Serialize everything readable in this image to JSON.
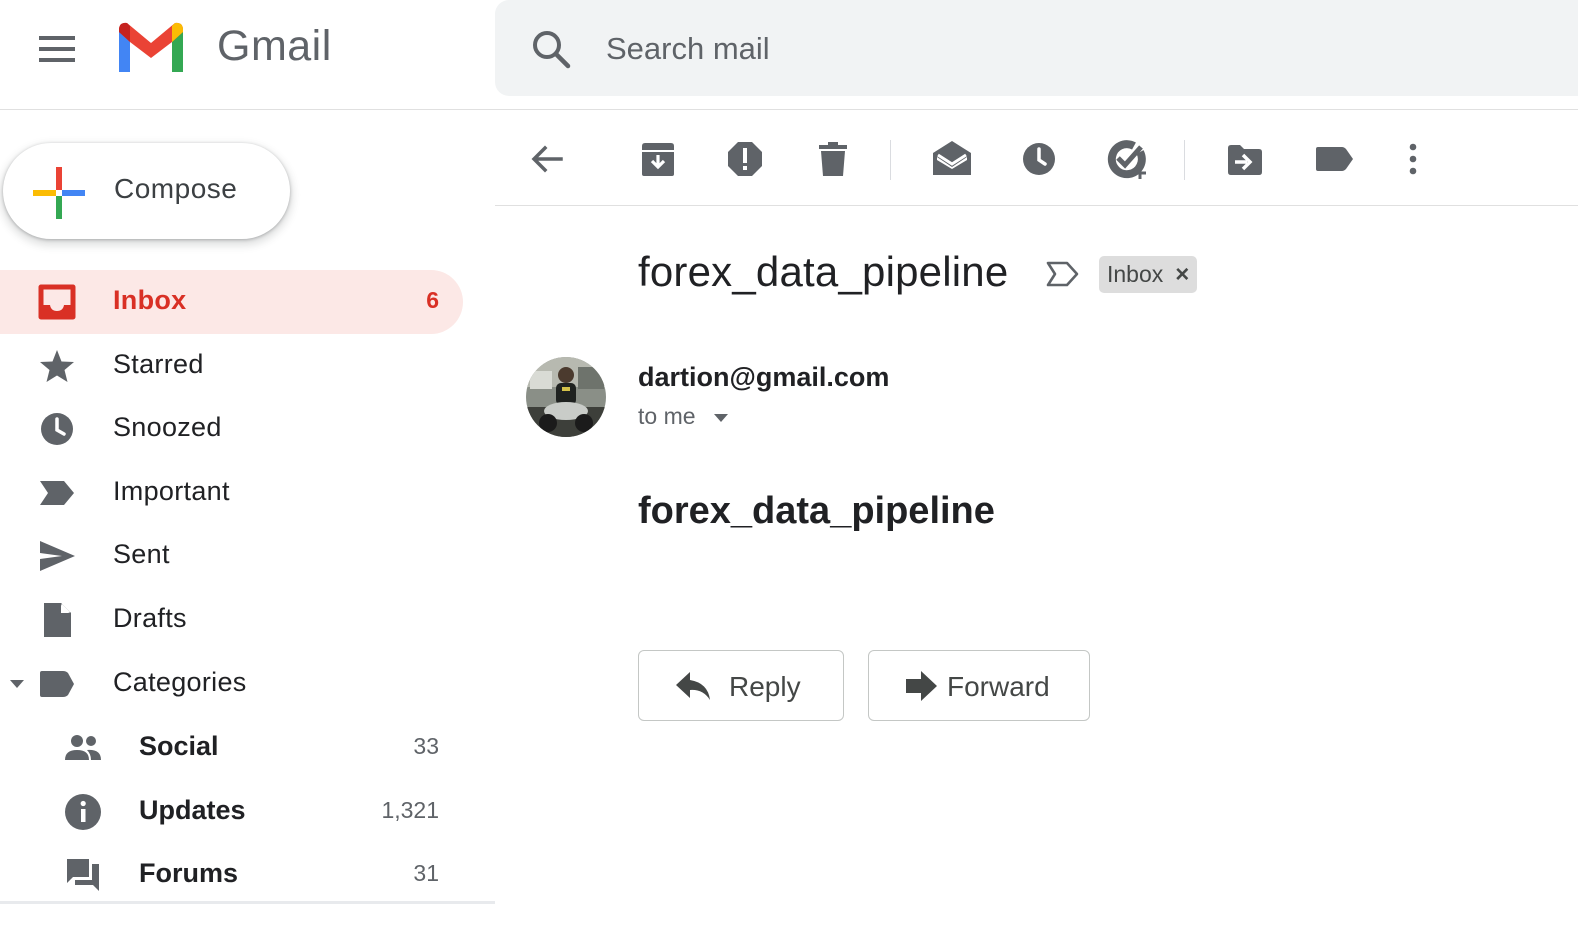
{
  "app": {
    "name": "Gmail"
  },
  "search": {
    "placeholder": "Search mail"
  },
  "compose": {
    "label": "Compose"
  },
  "sidebar": {
    "items": [
      {
        "label": "Inbox",
        "count": "6",
        "icon": "inbox-icon",
        "active": true
      },
      {
        "label": "Starred",
        "count": "",
        "icon": "star-icon"
      },
      {
        "label": "Snoozed",
        "count": "",
        "icon": "clock-icon"
      },
      {
        "label": "Important",
        "count": "",
        "icon": "important-icon"
      },
      {
        "label": "Sent",
        "count": "",
        "icon": "send-icon"
      },
      {
        "label": "Drafts",
        "count": "",
        "icon": "draft-icon"
      },
      {
        "label": "Categories",
        "count": "",
        "icon": "label-icon"
      }
    ],
    "categories": [
      {
        "label": "Social",
        "count": "33",
        "icon": "people-icon"
      },
      {
        "label": "Updates",
        "count": "1,321",
        "icon": "info-icon"
      },
      {
        "label": "Forums",
        "count": "31",
        "icon": "forum-icon"
      }
    ]
  },
  "toolbar": {
    "icons": [
      "back-arrow-icon",
      "archive-icon",
      "report-spam-icon",
      "delete-icon",
      "mark-unread-icon",
      "snooze-icon",
      "add-task-icon",
      "move-to-icon",
      "label-icon",
      "more-options-icon"
    ]
  },
  "message": {
    "subject": "forex_data_pipeline",
    "label_chip": "Inbox",
    "label_chip_close": "×",
    "sender": "dartion@gmail.com",
    "recipient": "to me",
    "body": "forex_data_pipeline",
    "reply_label": "Reply",
    "forward_label": "Forward"
  },
  "colors": {
    "accent_red": "#d93025",
    "active_bg": "#fce8e6",
    "icon_gray": "#5f6368",
    "search_bg": "#f1f3f4"
  }
}
